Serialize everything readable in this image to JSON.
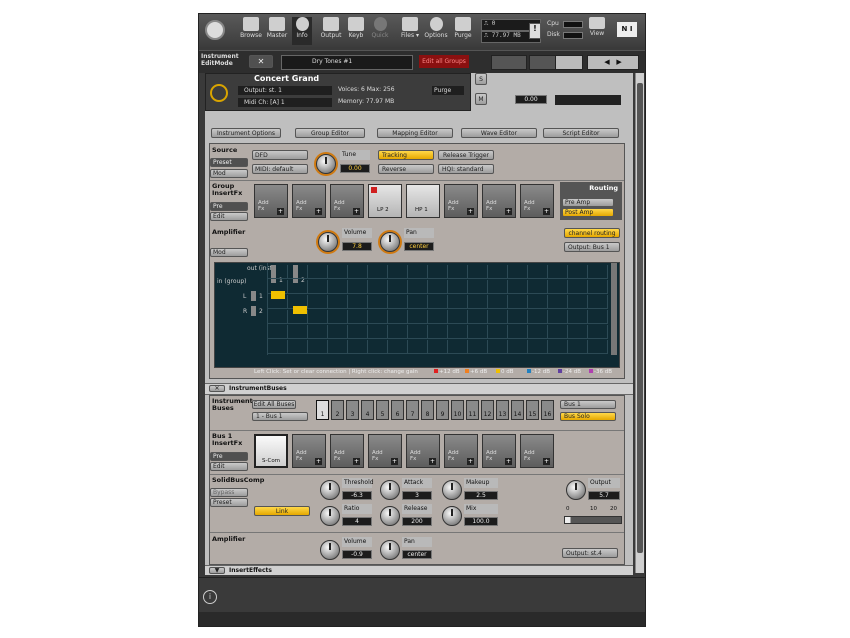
{
  "toolbar": {
    "browse": "Browse",
    "master": "Master",
    "info": "Info",
    "output": "Output",
    "keyb": "Keyb",
    "quick": "Quick",
    "files": "Files ▾",
    "options": "Options",
    "purge": "Purge",
    "midi_count": "⎍ 0",
    "memory": "⎍ 77.97 MB",
    "cpu": "Cpu",
    "disk": "Disk",
    "view": "View",
    "ni_logo": "N I"
  },
  "editbar": {
    "mode": "Instrument\nEditMode",
    "close": "✕",
    "group": "Dry Tones #1",
    "edit_all": "Edit all Groups"
  },
  "header": {
    "name": "Concert Grand",
    "output": "Output: st. 1",
    "voices": "Voices:   6   Max:   256",
    "purge": "Purge",
    "midi": "Midi Ch: [A]  1",
    "memory": "Memory: 77.97 MB",
    "tune": "0.00",
    "s_btn": "S",
    "m_btn": "M"
  },
  "tabs": [
    "Instrument Options",
    "Group Editor",
    "Mapping Editor",
    "Wave Editor",
    "Script Editor"
  ],
  "source": {
    "title": "Source",
    "preset": "Preset",
    "mod": "Mod",
    "mode": "DFD",
    "midi": "MIDI: default",
    "tune_label": "Tune",
    "tune_val": "0.00",
    "tracking": "Tracking",
    "reverse": "Reverse",
    "release": "Release Trigger",
    "hq": "HQI: standard"
  },
  "group_fx": {
    "title": "Group\nInsertFx",
    "pre": "Pre",
    "edit": "Edit",
    "routing": "Routing",
    "pre_amp": "Pre Amp",
    "post_amp": "Post Amp",
    "slots": [
      "Add\nFx",
      "Add\nFx",
      "Add\nFx",
      "LP 2",
      "HP 1",
      "Add\nFx",
      "Add\nFx",
      "Add\nFx"
    ]
  },
  "amplifier": {
    "title": "Amplifier",
    "mod": "Mod",
    "volume": "Volume",
    "vol_val": "7.8",
    "pan": "Pan",
    "pan_val": "center",
    "channel_routing": "channel routing",
    "output": "Output: Bus 1"
  },
  "matrix": {
    "out_label": "out (inst.)",
    "in_label": "in (group)",
    "col1": "1",
    "col2": "2",
    "row_l": "L",
    "row_r": "R",
    "row1": "1",
    "row2": "2",
    "hint": "Left Click: Set or clear connection | Right click: change gain",
    "legend": [
      "+12 dB",
      "+6 dB",
      "0 dB",
      "-12 dB",
      "-24 dB",
      "-36 dB"
    ],
    "legend_colors": [
      "#e02020",
      "#f08020",
      "#f0c000",
      "#2080c0",
      "#6040a0",
      "#b040b0"
    ]
  },
  "instbuses": {
    "title": "InstrumentBuses",
    "label": "Instrument\nBuses",
    "edit_all": "Edit All Buses",
    "bus_sel": "1 - Bus 1",
    "buses": [
      "1",
      "2",
      "3",
      "4",
      "5",
      "6",
      "7",
      "8",
      "9",
      "10",
      "11",
      "12",
      "13",
      "14",
      "15",
      "16"
    ],
    "bus_name": "Bus 1",
    "bus_solo": "Bus Solo"
  },
  "bus_fx": {
    "title": "Bus 1\nInsertFx",
    "pre": "Pre",
    "edit": "Edit",
    "slots": [
      "S-Com",
      "Add\nFx",
      "Add\nFx",
      "Add\nFx",
      "Add\nFx",
      "Add\nFx",
      "Add\nFx",
      "Add\nFx"
    ]
  },
  "comp": {
    "title": "SolidBusComp",
    "bypass": "Bypass",
    "preset": "Preset",
    "link": "Link",
    "threshold": "Threshold",
    "thr_val": "-6.3",
    "ratio": "Ratio",
    "ratio_val": "4",
    "attack": "Attack",
    "atk_val": "3",
    "release": "Release",
    "rel_val": "200",
    "makeup": "Makeup",
    "mk_val": "2.5",
    "mix": "Mix",
    "mix_val": "100.0",
    "output": "Output",
    "out_val": "5.7",
    "scale": [
      "0",
      "10",
      "20"
    ]
  },
  "amp2": {
    "title": "Amplifier",
    "volume": "Volume",
    "vol_val": "-0.9",
    "pan": "Pan",
    "pan_val": "center",
    "output": "Output: st.4"
  },
  "footer": {
    "insert_effects": "InsertEffects",
    "info_icon": "i"
  }
}
